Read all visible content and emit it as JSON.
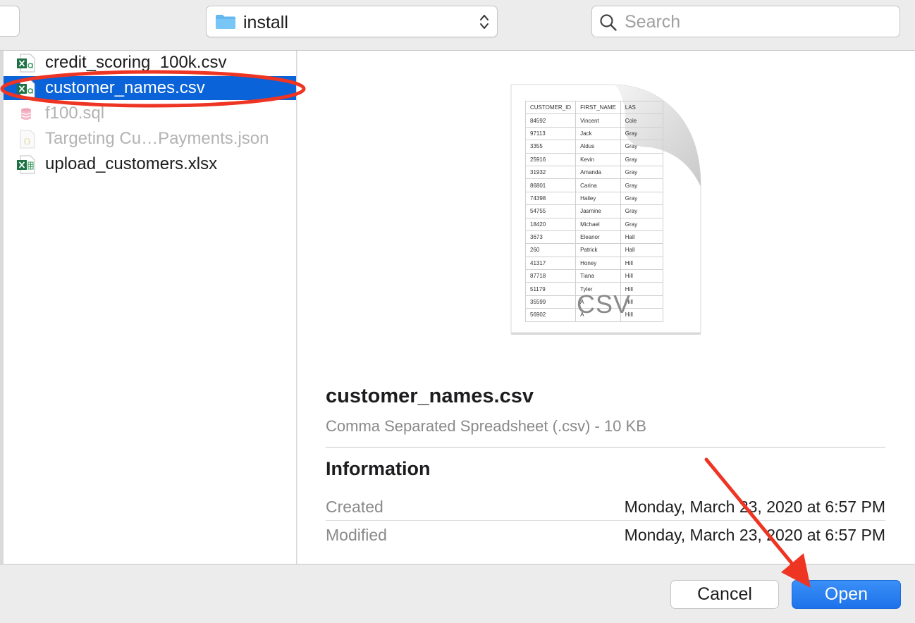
{
  "toolbar": {
    "location": "install",
    "search_placeholder": "Search"
  },
  "files": [
    {
      "name": "credit_scoring_100k.csv",
      "icon": "csv-file-icon",
      "state": "normal"
    },
    {
      "name": "customer_names.csv",
      "icon": "csv-file-icon",
      "state": "selected"
    },
    {
      "name": "f100.sql",
      "icon": "sql-file-icon",
      "state": "disabled"
    },
    {
      "name": "Targeting Cu…Payments.json",
      "icon": "json-file-icon",
      "state": "disabled"
    },
    {
      "name": "upload_customers.xlsx",
      "icon": "xlsx-file-icon",
      "state": "normal"
    }
  ],
  "preview": {
    "thumbnail": {
      "headers": [
        "CUSTOMER_ID",
        "FIRST_NAME",
        "LAS"
      ],
      "rows": [
        [
          "84592",
          "Vincent",
          "Cole"
        ],
        [
          "97113",
          "Jack",
          "Gray"
        ],
        [
          "3355",
          "Aldus",
          "Gray"
        ],
        [
          "25916",
          "Kevin",
          "Gray"
        ],
        [
          "31932",
          "Amanda",
          "Gray"
        ],
        [
          "86801",
          "Carina",
          "Gray"
        ],
        [
          "74398",
          "Hailey",
          "Gray"
        ],
        [
          "54755",
          "Jasmine",
          "Gray"
        ],
        [
          "18420",
          "Michael",
          "Gray"
        ],
        [
          "3673",
          "Eleanor",
          "Hall"
        ],
        [
          "260",
          "Patrick",
          "Hall"
        ],
        [
          "41317",
          "Honey",
          "Hill"
        ],
        [
          "87718",
          "Tiana",
          "Hill"
        ],
        [
          "51179",
          "Tyler",
          "Hill"
        ],
        [
          "35599",
          "A",
          "Hill"
        ],
        [
          "56902",
          "A",
          "Hill"
        ]
      ],
      "badge": "CSV"
    },
    "name": "customer_names.csv",
    "kind": "Comma Separated Spreadsheet (.csv) - 10 KB",
    "info_heading": "Information",
    "info": [
      {
        "label": "Created",
        "value": "Monday, March 23, 2020 at 6:57 PM"
      },
      {
        "label": "Modified",
        "value": "Monday, March 23, 2020 at 6:57 PM"
      }
    ]
  },
  "footer": {
    "cancel_label": "Cancel",
    "open_label": "Open"
  },
  "colors": {
    "selection": "#0a63d8",
    "primary_button": "#1d72ea",
    "annotation": "#ee3524"
  }
}
